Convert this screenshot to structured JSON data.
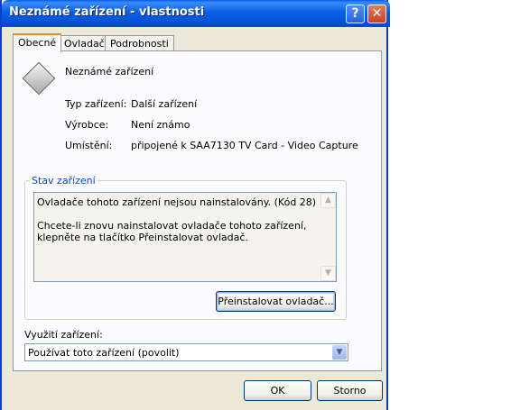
{
  "window": {
    "title": "Neznámé zařízení - vlastnosti",
    "help_label": "?",
    "close_label": "✕"
  },
  "tabs": [
    {
      "label": "Obecné",
      "active": true
    },
    {
      "label": "Ovladač",
      "active": false
    },
    {
      "label": "Podrobnosti",
      "active": false
    }
  ],
  "device": {
    "icon": "unknown-device-icon",
    "name": "Neznámé zařízení",
    "type_label": "Typ zařízení:",
    "type_value": "Další zařízení",
    "manufacturer_label": "Výrobce:",
    "manufacturer_value": "Není známo",
    "location_label": "Umístění:",
    "location_value": "připojené k SAA7130 TV Card - Video Capture"
  },
  "status": {
    "group_label": "Stav zařízení",
    "line1": "Ovladače tohoto zařízení nejsou nainstalovány. (Kód 28)",
    "line2": "Chcete-li znovu nainstalovat ovladače tohoto zařízení, klepněte na tlačítko Přeinstalovat ovladač.",
    "reinstall_label": "Přeinstalovat ovladač..."
  },
  "usage": {
    "label": "Využití zařízení:",
    "selected": "Používat toto zařízení (povolit)"
  },
  "footer": {
    "ok_label": "OK",
    "cancel_label": "Storno"
  }
}
